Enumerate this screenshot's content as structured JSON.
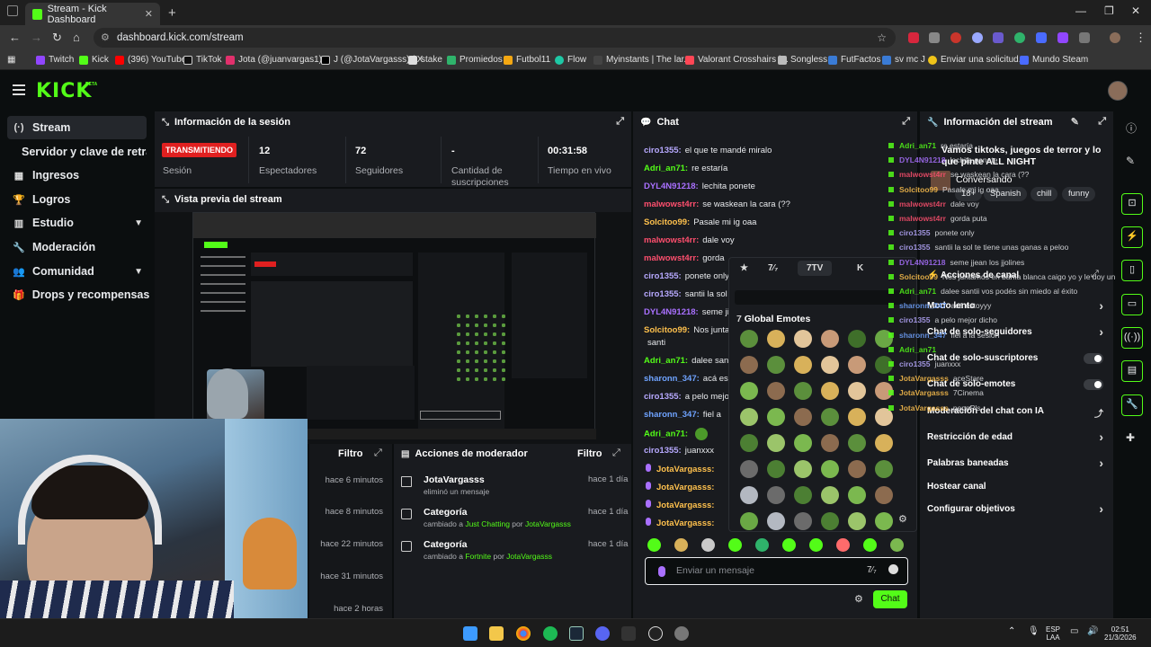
{
  "browser": {
    "tab_title": "Stream - Kick Dashboard",
    "url": "dashboard.kick.com/stream",
    "bookmarks": [
      "Twitch",
      "Kick",
      "(396) YouTube",
      "TikTok",
      "Jota (@juanvargas1)...",
      "J (@JotaVargasss) / X",
      "stake",
      "Promiedos",
      "Futbol11",
      "Flow",
      "Myinstants | The lar...",
      "Valorant Crosshairs |...",
      "Songless",
      "FutFactos",
      "sv mc J",
      "Enviar una solicitud...",
      "Mundo Steam"
    ]
  },
  "header": {
    "logo": "KICK",
    "beta": "BETA"
  },
  "sidebar": {
    "items": [
      {
        "label": "Stream",
        "icon": "(·)"
      },
      {
        "label": "Servidor y clave de retransmisión",
        "icon": ""
      },
      {
        "label": "Ingresos",
        "icon": "▦"
      },
      {
        "label": "Logros",
        "icon": "🏆"
      },
      {
        "label": "Estudio",
        "icon": "▥"
      },
      {
        "label": "Moderación",
        "icon": "🔧"
      },
      {
        "label": "Comunidad",
        "icon": "👥"
      },
      {
        "label": "Drops y recompensas",
        "icon": "🎁"
      }
    ]
  },
  "session": {
    "title": "Información de la sesión",
    "badge": "TRANSMITIENDO",
    "badge_label": "Sesión",
    "stats": [
      {
        "value": "12",
        "label": "Espectadores"
      },
      {
        "value": "72",
        "label": "Seguidores"
      },
      {
        "value": "-",
        "label": "Cantidad de suscripciones"
      },
      {
        "value": "00:31:58",
        "label": "Tiempo en vivo"
      }
    ]
  },
  "preview": {
    "title": "Vista previa del stream"
  },
  "history": {
    "filter": "Filtro",
    "times": [
      "hace 6 minutos",
      "hace 8 minutos",
      "hace 22 minutos",
      "hace 31 minutos",
      "hace 2 horas"
    ]
  },
  "modactions": {
    "title": "Acciones de moderador",
    "filter": "Filtro",
    "rows": [
      {
        "title": "JotaVargasss",
        "sub": "eliminó un mensaje",
        "when": "hace 1 día"
      },
      {
        "title": "Categoría",
        "sub_pre": "cambiado a ",
        "cat": "Just Chatting",
        "by": " por ",
        "user": "JotaVargasss",
        "when": "hace 1 día"
      },
      {
        "title": "Categoría",
        "sub_pre": "cambiado a ",
        "cat": "Fortnite",
        "by": " por ",
        "user": "JotaVargasss",
        "when": "hace 1 día"
      }
    ]
  },
  "chat": {
    "title": "Chat",
    "messages": [
      {
        "user": "ciro1355:",
        "text": "el que te mandé miralo",
        "color": "#b7a9ff"
      },
      {
        "user": "Adri_an71:",
        "text": "re estaría",
        "color": "#53fc18"
      },
      {
        "user": "DYL4N91218:",
        "text": "lechita ponete",
        "color": "#a970ff"
      },
      {
        "user": "malwowst4rr:",
        "text": "se waskean la cara (??",
        "color": "#ff4f6e"
      },
      {
        "user": "Solcitoo99:",
        "text": "Pasale mi ig oaa",
        "color": "#ffc14d"
      },
      {
        "user": "malwowst4rr:",
        "text": "dale voy",
        "color": "#ff4f6e"
      },
      {
        "user": "malwowst4rr:",
        "text": "gorda",
        "color": "#ff4f6e"
      },
      {
        "user": "ciro1355:",
        "text": "ponete only",
        "color": "#b7a9ff"
      },
      {
        "user": "ciro1355:",
        "text": "santii la sol",
        "color": "#b7a9ff"
      },
      {
        "user": "DYL4N91218:",
        "text": "seme ji",
        "color": "#a970ff"
      },
      {
        "user": "Solcitoo99:",
        "text": "Nos junta",
        "color": "#ffc14d"
      },
      {
        "user": "",
        "text": "santi",
        "color": "#e8eaed"
      },
      {
        "user": "Adri_an71:",
        "text": "dalee sant",
        "color": "#53fc18"
      },
      {
        "user": "sharonn_347:",
        "text": "acá es",
        "color": "#6fa3ff"
      },
      {
        "user": "ciro1355:",
        "text": "a pelo mejo",
        "color": "#b7a9ff"
      },
      {
        "user": "sharonn_347:",
        "text": "fiel a",
        "color": "#6fa3ff"
      },
      {
        "user": "Adri_an71:",
        "text": "",
        "color": "#53fc18"
      },
      {
        "user": "ciro1355:",
        "text": "juanxxx",
        "color": "#b7a9ff"
      },
      {
        "user": "JotaVargasss:",
        "text": "",
        "color": "#ffc14d"
      },
      {
        "user": "JotaVargasss:",
        "text": "",
        "color": "#ffc14d"
      },
      {
        "user": "JotaVargasss:",
        "text": "",
        "color": "#ffc14d"
      },
      {
        "user": "JotaVargasss:",
        "text": "",
        "color": "#ffc14d"
      }
    ],
    "input_placeholder": "Enviar un mensaje",
    "send_label": "Chat"
  },
  "emotes": {
    "tabs": [
      "★",
      "7TV"
    ],
    "active_tab": "7TV",
    "section": "Global Emotes"
  },
  "info": {
    "title": "Información del stream",
    "stream_title": "Vamos tiktoks, juegos de terror y lo que pinte ALL NIGHT",
    "category": "Conversando",
    "tags": [
      "18+",
      "Spanish",
      "chill",
      "funny"
    ]
  },
  "mod_settings": {
    "title": "Acciones de canal",
    "rows": [
      {
        "label": "Modo lento",
        "kind": "chevron"
      },
      {
        "label": "Chat de solo-seguidores",
        "kind": "chevron"
      },
      {
        "label": "Chat de solo-suscriptores",
        "kind": "toggle"
      },
      {
        "label": "Chat de solo-emotes",
        "kind": "toggle"
      },
      {
        "label": "Moderación del chat con IA",
        "kind": "link"
      },
      {
        "label": "Restricción de edad",
        "kind": "chevron"
      },
      {
        "label": "Palabras baneadas",
        "kind": "chevron"
      },
      {
        "label": "Hostear canal",
        "kind": "none"
      },
      {
        "label": "Configurar objetivos",
        "kind": "chevron"
      }
    ]
  },
  "overlay_chat": [
    {
      "user": "Adri_an71",
      "text": "re estaría",
      "color": "#53fc18"
    },
    {
      "user": "DYL4N91218",
      "text": "lechita ponete",
      "color": "#a970ff"
    },
    {
      "user": "malwowst4rr",
      "text": "se waskean la cara (??",
      "color": "#ff4f6e"
    },
    {
      "user": "Solcitoo99",
      "text": "Pasale mi ig oaa",
      "color": "#ffc14d"
    },
    {
      "user": "malwowst4rr",
      "text": "dale voy",
      "color": "#ff4f6e"
    },
    {
      "user": "malwowst4rr",
      "text": "gorda puta",
      "color": "#ff4f6e"
    },
    {
      "user": "ciro1355",
      "text": "ponete only",
      "color": "#b7a9ff"
    },
    {
      "user": "ciro1355",
      "text": "santii la sol te tiene unas ganas a peloo",
      "color": "#b7a9ff"
    },
    {
      "user": "DYL4N91218",
      "text": "seme jjean los jjolines",
      "color": "#a970ff"
    },
    {
      "user": "Solcitoo99",
      "text": "Nos juntamos en bahía blanca caigo yo y le doy un beso a santi",
      "color": "#ffc14d"
    },
    {
      "user": "Adri_an71",
      "text": "dalee santii vos podés sin miedo al éxito",
      "color": "#53fc18"
    },
    {
      "user": "sharonn_347",
      "text": "acá estoyyy",
      "color": "#6fa3ff"
    },
    {
      "user": "ciro1355",
      "text": "a pelo mejor dicho",
      "color": "#b7a9ff"
    },
    {
      "user": "sharonn_347",
      "text": "fiel a la sesión",
      "color": "#6fa3ff"
    },
    {
      "user": "Adri_an71",
      "text": "",
      "color": "#53fc18"
    },
    {
      "user": "ciro1355",
      "text": "juanxxx",
      "color": "#b7a9ff"
    },
    {
      "user": "JotaVargasss",
      "text": "aceStare",
      "color": "#ffc14d"
    },
    {
      "user": "JotaVargasss",
      "text": "7Cinema",
      "color": "#ffc14d"
    },
    {
      "user": "JotaVargasss",
      "text": "pepePls",
      "color": "#ffc14d"
    }
  ],
  "taskbar": {
    "lang": "ESP",
    "lang2": "LAA",
    "time": "02:51",
    "date": "21/3/2026"
  }
}
